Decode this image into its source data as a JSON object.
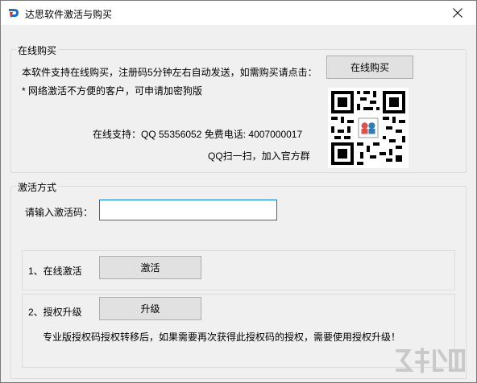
{
  "window": {
    "title": "达思软件激活与购买",
    "close_icon": "close-icon"
  },
  "purchase": {
    "legend": "在线购买",
    "line1": "本软件支持在线购买，注册码5分钟左右自动发送，如需购买请点击：",
    "button": "在线购买",
    "line2": "* 网络激活不方便的客户，可申请加密狗版",
    "support": "在线支持：QQ 55356052  免费电话: 4007000017",
    "qq_scan": "QQ扫一扫，加入官方群"
  },
  "activation": {
    "legend": "激活方式",
    "code_label": "请输入激活码：",
    "code_value": "",
    "online": {
      "label": "1、在线激活",
      "button": "激活"
    },
    "upgrade": {
      "label": "2、授权升级",
      "button": "升级",
      "note": "专业版授权码授权转移后，如果需要再次获得此授权码的授权，需要使用授权升级！"
    }
  }
}
